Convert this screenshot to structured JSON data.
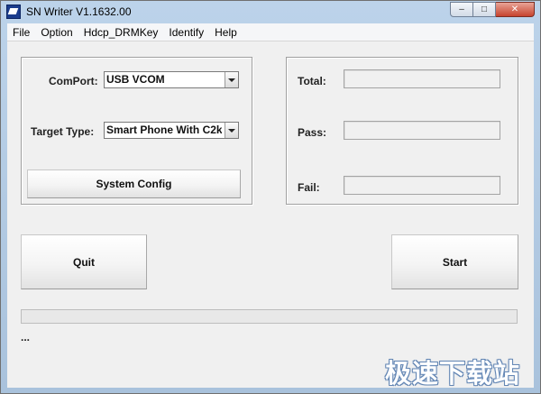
{
  "window": {
    "title": "SN Writer V1.1632.00",
    "controls": {
      "minimize": "–",
      "maximize": "□",
      "close": "✕"
    }
  },
  "menu": [
    "File",
    "Option",
    "Hdcp_DRMKey",
    "Identify",
    "Help"
  ],
  "settings": {
    "comport_label": "ComPort:",
    "comport_value": "USB VCOM",
    "target_label": "Target Type:",
    "target_value": "Smart Phone With C2k",
    "system_config_label": "System Config"
  },
  "stats": {
    "total_label": "Total:",
    "pass_label": "Pass:",
    "fail_label": "Fail:",
    "total_value": "",
    "pass_value": "",
    "fail_value": ""
  },
  "actions": {
    "quit_label": "Quit",
    "start_label": "Start"
  },
  "status_text": "...",
  "watermark": "极速下载站",
  "icons": {
    "app": "app-icon",
    "dropdown": "chevron-down-icon"
  }
}
